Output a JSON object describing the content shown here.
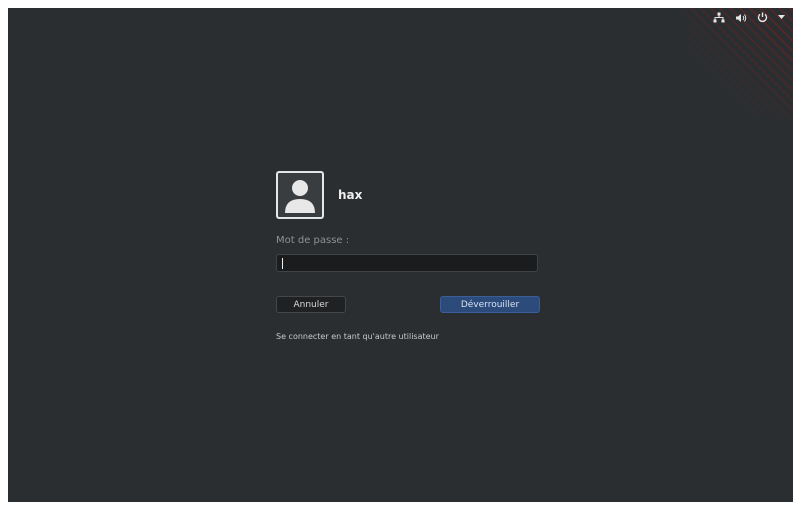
{
  "system": {
    "network_icon": "network-icon",
    "volume_icon": "volume-icon",
    "power_icon": "power-icon",
    "menu_icon": "chevron-down-icon"
  },
  "login": {
    "username": "hax",
    "password_label": "Mot de passe :",
    "password_value": "",
    "cancel_label": "Annuler",
    "unlock_label": "Déverrouiller",
    "other_user_link": "Se connecter en tant qu'autre utilisateur"
  },
  "colors": {
    "background": "#2b2e30",
    "accent": "#2c4a7a"
  }
}
